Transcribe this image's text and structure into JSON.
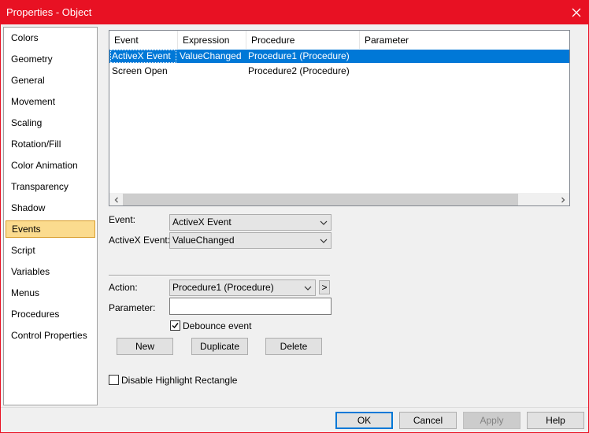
{
  "window": {
    "title": "Properties - Object",
    "close_icon": "close-icon"
  },
  "nav": {
    "items": [
      {
        "label": "Colors",
        "selected": false
      },
      {
        "label": "Geometry",
        "selected": false
      },
      {
        "label": "General",
        "selected": false
      },
      {
        "label": "Movement",
        "selected": false
      },
      {
        "label": "Scaling",
        "selected": false
      },
      {
        "label": "Rotation/Fill",
        "selected": false
      },
      {
        "label": "Color Animation",
        "selected": false
      },
      {
        "label": "Transparency",
        "selected": false
      },
      {
        "label": "Shadow",
        "selected": false
      },
      {
        "label": "Events",
        "selected": true
      },
      {
        "label": "Script",
        "selected": false
      },
      {
        "label": "Variables",
        "selected": false
      },
      {
        "label": "Menus",
        "selected": false
      },
      {
        "label": "Procedures",
        "selected": false
      },
      {
        "label": "Control Properties",
        "selected": false
      }
    ]
  },
  "events_list": {
    "columns": [
      "Event",
      "Expression",
      "Procedure",
      "Parameter"
    ],
    "rows": [
      {
        "event": "ActiveX Event",
        "expression": "ValueChanged",
        "procedure": "Procedure1 (Procedure)",
        "parameter": "",
        "selected": true
      },
      {
        "event": "Screen Open",
        "expression": "",
        "procedure": "Procedure2 (Procedure)",
        "parameter": "",
        "selected": false
      }
    ]
  },
  "form": {
    "event_label": "Event:",
    "event_value": "ActiveX Event",
    "activex_label": "ActiveX Event:",
    "activex_value": "ValueChanged",
    "action_label": "Action:",
    "action_value": "Procedure1 (Procedure)",
    "action_browse_label": ">",
    "parameter_label": "Parameter:",
    "parameter_value": "",
    "debounce_label": "Debounce event",
    "debounce_checked": true,
    "new_label": "New",
    "duplicate_label": "Duplicate",
    "delete_label": "Delete",
    "disable_highlight_label": "Disable Highlight Rectangle",
    "disable_highlight_checked": false
  },
  "dialog_buttons": {
    "ok": "OK",
    "cancel": "Cancel",
    "apply": "Apply",
    "help": "Help"
  },
  "colors": {
    "titlebar": "#e81123",
    "selection": "#0078d7",
    "nav_selected": "#fbdb8e"
  }
}
